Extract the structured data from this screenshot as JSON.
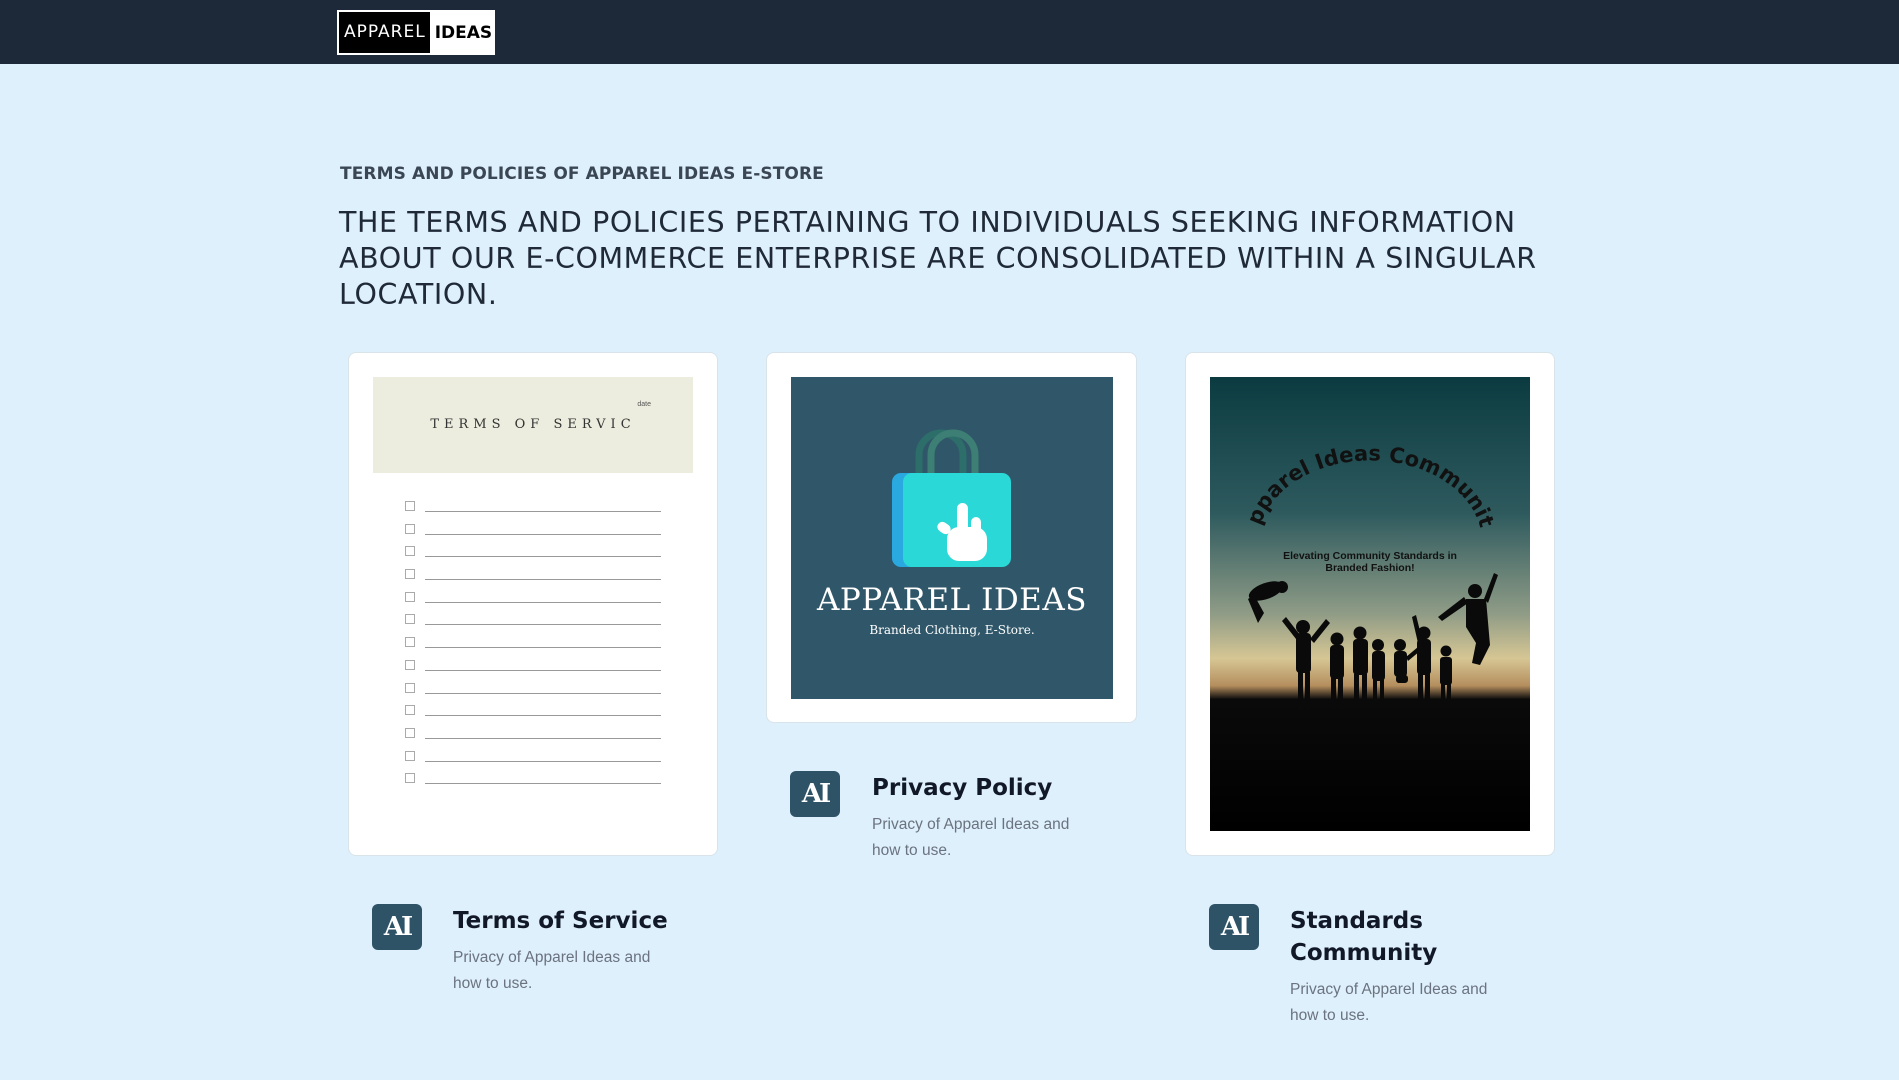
{
  "nav": {
    "logo_left": "APPAREL",
    "logo_right": "IDEAS"
  },
  "hero": {
    "eyebrow": "TERMS AND POLICIES OF APPAREL IDEAS E-STORE",
    "headline": "THE TERMS AND POLICIES PERTAINING TO INDIVIDUALS SEEKING INFORMATION ABOUT OUR E-COMMERCE ENTERPRISE ARE CONSOLIDATED WITHIN A SINGULAR LOCATION."
  },
  "cards": {
    "terms": {
      "image_title": "TERMS OF SERVIC",
      "image_date": "date",
      "checklist_rows": 13,
      "icon_text": "AI",
      "title": "Terms of Service",
      "desc_line1": "Privacy of Apparel Ideas and",
      "desc_line2": "how to use."
    },
    "privacy": {
      "image_brand": "APPAREL IDEAS",
      "image_sub": "Branded Clothing, E-Store.",
      "icon_text": "AI",
      "title": "Privacy Policy",
      "desc_line1": "Privacy of Apparel Ideas and",
      "desc_line2": "how to use."
    },
    "community": {
      "image_arc_text": "Apparel Ideas Community",
      "image_tagline_1": "Elevating Community Standards in",
      "image_tagline_2": "Branded Fashion!",
      "icon_text": "AI",
      "title_line1": "Standards",
      "title_line2": "Community",
      "desc_line1": "Privacy of Apparel Ideas and",
      "desc_line2": "how to use."
    }
  },
  "colors": {
    "page_bg": "#def0fb",
    "navbar": "#1d2939",
    "icon_bg": "#2e5367",
    "privacy_bg": "#305769",
    "bag_front": "#2ad8d8",
    "bag_back": "#2aa8e0"
  },
  "icons": [
    "logo",
    "shopping-bag-icon",
    "pointer-hand-icon",
    "ai-monogram-icon"
  ]
}
